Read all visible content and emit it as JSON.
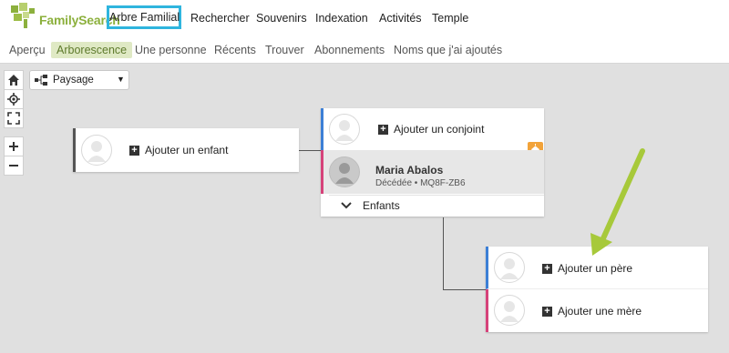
{
  "brand": {
    "name": "FamilySearch",
    "color": "#8cb03d"
  },
  "nav": {
    "active_label": "Arbre Familial",
    "items": [
      "Rechercher",
      "Souvenirs",
      "Indexation",
      "Activités",
      "Temple"
    ]
  },
  "subnav": {
    "items": [
      "Aperçu",
      "Arborescence",
      "Une personne",
      "Récents",
      "Trouver",
      "Abonnements",
      "Noms que j'ai ajoutés"
    ],
    "active_index": 1
  },
  "controls": {
    "icons": [
      "home-icon",
      "locate-icon",
      "fullscreen-icon",
      "zoom-in-icon",
      "zoom-out-icon"
    ]
  },
  "layout_select": {
    "value": "Paysage"
  },
  "child_card": {
    "add_label": "Ajouter un enfant"
  },
  "couple_card": {
    "add_spouse_label": "Ajouter un conjoint",
    "person": {
      "name": "Maria Abalos",
      "details": "Décédée • MQ8F-ZB6"
    },
    "children_label": "Enfants"
  },
  "parents_card": {
    "add_father_label": "Ajouter un père",
    "add_mother_label": "Ajouter une mère"
  },
  "colors": {
    "accent_blue": "#2fb5de",
    "male": "#3c7fd6",
    "female": "#d6427a",
    "temple": "#f2a33a",
    "arrow": "#a7c93a"
  }
}
